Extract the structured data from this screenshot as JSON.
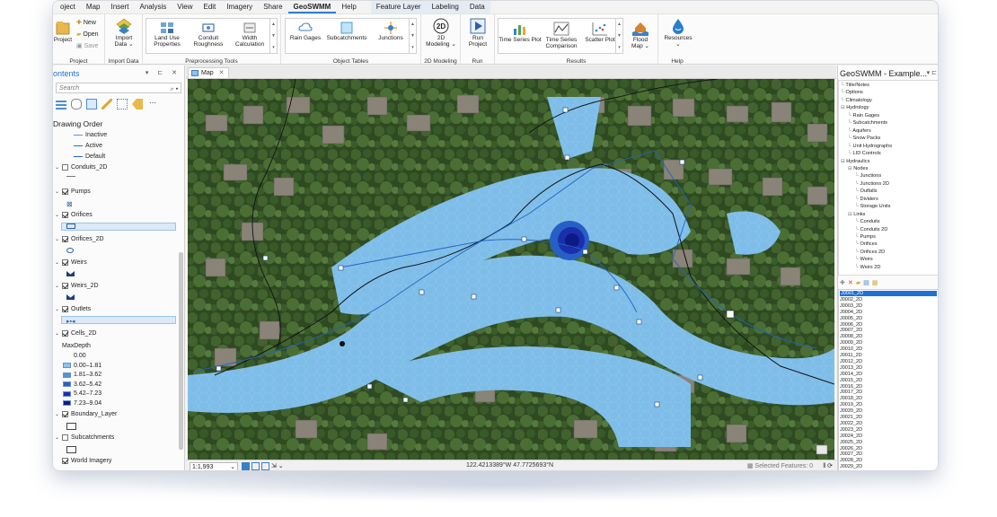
{
  "menu": [
    "oject",
    "Map",
    "Insert",
    "Analysis",
    "View",
    "Edit",
    "Imagery",
    "Share",
    "GeoSWMM",
    "Help",
    "Feature Layer",
    "Labeling",
    "Data"
  ],
  "ribbon": {
    "project": {
      "label": "Project",
      "new": "New",
      "open": "Open",
      "save": "Save",
      "group": "Project"
    },
    "import": {
      "label": "Import\nData ⌄",
      "group": "Import Data"
    },
    "preprocessing": {
      "items": [
        "Land Use\nProperties",
        "Conduit\nRoughness",
        "Width\nCalculation"
      ],
      "group": "Preprocessing Tools"
    },
    "object_tables": {
      "items": [
        "Rain Gages",
        "Subcatchments",
        "Junctions"
      ],
      "group": "Object Tables"
    },
    "modeling2d": {
      "label": "2D\nModeling ⌄",
      "group": "2D Modeling"
    },
    "run": {
      "label": "Run\nProject",
      "group": "Run"
    },
    "results": {
      "items": [
        "Time Series Plot",
        "Time Series\nComparison",
        "Scatter Plot"
      ],
      "flood": "Flood\nMap ⌄",
      "group": "Results"
    },
    "help": {
      "label": "Resources\n⌄",
      "group": "Help"
    }
  },
  "contents": {
    "title": "ontents",
    "search_placeholder": "Search",
    "heading": "Drawing Order",
    "legend_top": [
      "Inactive",
      "Active",
      "Default"
    ],
    "layers": [
      {
        "name": "Conduits_2D",
        "checked": false
      },
      {
        "name": "Pumps",
        "checked": true
      },
      {
        "name": "Orifices",
        "checked": true
      },
      {
        "name": "Orifices_2D",
        "checked": true
      },
      {
        "name": "Weirs",
        "checked": true
      },
      {
        "name": "Weirs_2D",
        "checked": true
      },
      {
        "name": "Outlets",
        "checked": true
      },
      {
        "name": "Cells_2D",
        "checked": true
      },
      {
        "name": "Boundary_Layer",
        "checked": true
      },
      {
        "name": "Subcatchments",
        "checked": false
      },
      {
        "name": "World Imagery",
        "checked": true
      }
    ],
    "maxdepth_label": "MaxDepth",
    "maxdepth_classes": [
      {
        "label": "0.00",
        "color": ""
      },
      {
        "label": "0.00–1.81",
        "color": "#8cc4ee"
      },
      {
        "label": "1.81–3.62",
        "color": "#4d95dc"
      },
      {
        "label": "3.62–5.42",
        "color": "#2760c4"
      },
      {
        "label": "5.42–7.23",
        "color": "#1b2fae"
      },
      {
        "label": "7.23–9.04",
        "color": "#0d1a86"
      }
    ]
  },
  "map": {
    "tab": "Map",
    "scale": "1:1,993",
    "coordinates": "122.4213389°W 47.7725693°N",
    "selected_features": "Selected Features: 0"
  },
  "rpanel": {
    "title": "GeoSWMM - Example...",
    "tree": [
      {
        "t": "Title/Notes",
        "d": 1
      },
      {
        "t": "Options",
        "d": 1
      },
      {
        "t": "Climatology",
        "d": 1
      },
      {
        "t": "Hydrology",
        "d": 1,
        "exp": true
      },
      {
        "t": "Rain Gages",
        "d": 2
      },
      {
        "t": "Subcatchments",
        "d": 2
      },
      {
        "t": "Aquifers",
        "d": 2
      },
      {
        "t": "Snow Packs",
        "d": 2
      },
      {
        "t": "Unit Hydrographs",
        "d": 2
      },
      {
        "t": "LID Controls",
        "d": 2
      },
      {
        "t": "Hydraulics",
        "d": 1,
        "exp": true
      },
      {
        "t": "Nodes",
        "d": 2,
        "exp": true
      },
      {
        "t": "Junctions",
        "d": 3
      },
      {
        "t": "Junctions 2D",
        "d": 3
      },
      {
        "t": "Outfalls",
        "d": 3
      },
      {
        "t": "Dividers",
        "d": 3
      },
      {
        "t": "Storage Units",
        "d": 3
      },
      {
        "t": "Links",
        "d": 2,
        "exp": true
      },
      {
        "t": "Conduits",
        "d": 3
      },
      {
        "t": "Conduits 2D",
        "d": 3
      },
      {
        "t": "Pumps",
        "d": 3
      },
      {
        "t": "Orifices",
        "d": 3
      },
      {
        "t": "Orifices 2D",
        "d": 3
      },
      {
        "t": "Weirs",
        "d": 3
      },
      {
        "t": "Weirs 2D",
        "d": 3
      }
    ],
    "list": [
      "J0001_2D",
      "J0002_2D",
      "J0003_2D",
      "J0004_2D",
      "J0005_2D",
      "J0006_2D",
      "J0007_2D",
      "J0008_2D",
      "J0009_2D",
      "J0010_2D",
      "J0011_2D",
      "J0012_2D",
      "J0013_2D",
      "J0014_2D",
      "J0015_2D",
      "J0016_2D",
      "J0017_2D",
      "J0018_2D",
      "J0019_2D",
      "J0020_2D",
      "J0021_2D",
      "J0022_2D",
      "J0023_2D",
      "J0024_2D",
      "J0025_2D",
      "J0026_2D",
      "J0027_2D",
      "J0028_2D",
      "J0029_2D"
    ]
  },
  "colors": {
    "accent": "#1f6fd6",
    "flood_light": "#7fbde9",
    "flood_dark": "#0d1a86"
  }
}
